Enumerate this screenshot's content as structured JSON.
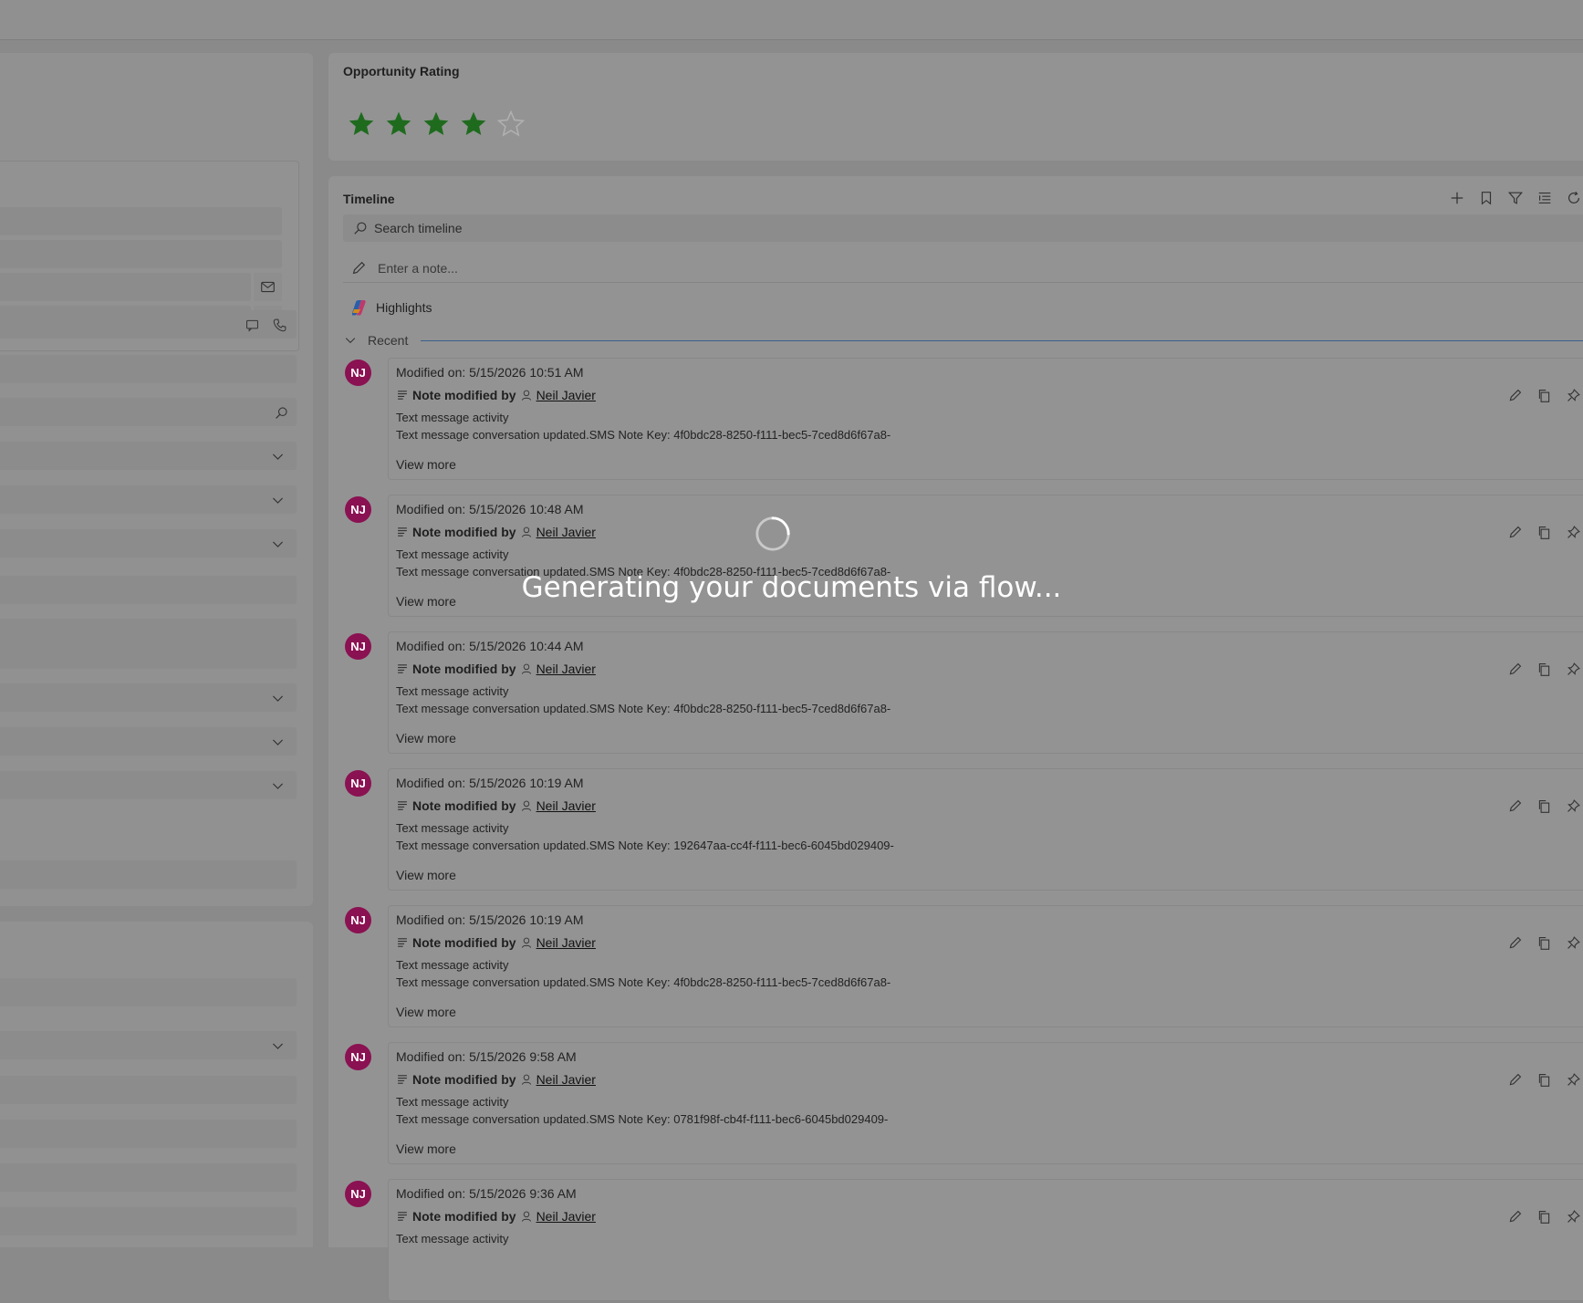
{
  "rating": {
    "title": "Opportunity Rating",
    "value": 4,
    "max": 5,
    "filled_color": "#1e6b1e"
  },
  "timeline": {
    "title": "Timeline",
    "search_placeholder": "Search timeline",
    "note_placeholder": "Enter a note...",
    "highlights_label": "Highlights",
    "recent_label": "Recent",
    "tools": [
      "add-icon",
      "bookmark-icon",
      "filter-icon",
      "list-icon",
      "refresh-icon"
    ],
    "entries": [
      {
        "initials": "NJ",
        "modified": "Modified on: 5/15/2026 10:51 AM",
        "action": "Note modified by",
        "user": "Neil Javier",
        "line1": "Text message activity",
        "line2": "Text message conversation updated.SMS Note Key: 4f0bdc28-8250-f111-bec5-7ced8d6f67a8-",
        "view_more": "View more"
      },
      {
        "initials": "NJ",
        "modified": "Modified on: 5/15/2026 10:48 AM",
        "action": "Note modified by",
        "user": "Neil Javier",
        "line1": "Text message activity",
        "line2": "Text message conversation updated.SMS Note Key: 4f0bdc28-8250-f111-bec5-7ced8d6f67a8-",
        "view_more": "View more"
      },
      {
        "initials": "NJ",
        "modified": "Modified on: 5/15/2026 10:44 AM",
        "action": "Note modified by",
        "user": "Neil Javier",
        "line1": "Text message activity",
        "line2": "Text message conversation updated.SMS Note Key: 4f0bdc28-8250-f111-bec5-7ced8d6f67a8-",
        "view_more": "View more"
      },
      {
        "initials": "NJ",
        "modified": "Modified on: 5/15/2026 10:19 AM",
        "action": "Note modified by",
        "user": "Neil Javier",
        "line1": "Text message activity",
        "line2": "Text message conversation updated.SMS Note Key: 192647aa-cc4f-f111-bec6-6045bd029409-",
        "view_more": "View more"
      },
      {
        "initials": "NJ",
        "modified": "Modified on: 5/15/2026 10:19 AM",
        "action": "Note modified by",
        "user": "Neil Javier",
        "line1": "Text message activity",
        "line2": "Text message conversation updated.SMS Note Key: 4f0bdc28-8250-f111-bec5-7ced8d6f67a8-",
        "view_more": "View more"
      },
      {
        "initials": "NJ",
        "modified": "Modified on: 5/15/2026 9:58 AM",
        "action": "Note modified by",
        "user": "Neil Javier",
        "line1": "Text message activity",
        "line2": "Text message conversation updated.SMS Note Key: 0781f98f-cb4f-f111-bec6-6045bd029409-",
        "view_more": "View more"
      },
      {
        "initials": "NJ",
        "modified": "Modified on: 5/15/2026 9:36 AM",
        "action": "Note modified by",
        "user": "Neil Javier",
        "line1": "Text message activity",
        "line2": "",
        "view_more": ""
      }
    ]
  },
  "overlay": {
    "message": "Generating your documents via flow..."
  },
  "colors": {
    "avatar": "#8a1152",
    "overlay_text": "#ffffff",
    "recent_line": "#3b5e8c"
  }
}
